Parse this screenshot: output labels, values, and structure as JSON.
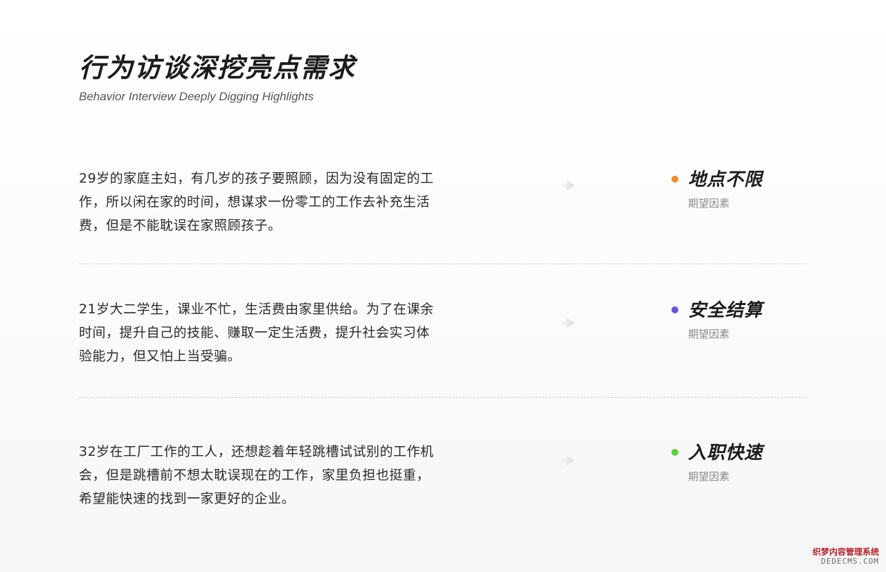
{
  "header": {
    "title": "行为访谈深挖亮点需求",
    "subtitle": "Behavior Interview Deeply Digging Highlights"
  },
  "rows": [
    {
      "description": "29岁的家庭主妇，有几岁的孩子要照顾，因为没有固定的工作，所以闲在家的时间，想谋求一份零工的工作去补充生活费，但是不能耽误在家照顾孩子。",
      "factor": "地点不限",
      "caption": "期望因素",
      "dot_color": "#f0892a"
    },
    {
      "description": "21岁大二学生，课业不忙，生活费由家里供给。为了在课余时间，提升自己的技能、赚取一定生活费，提升社会实习体验能力，但又怕上当受骗。",
      "factor": "安全结算",
      "caption": "期望因素",
      "dot_color": "#6b4fe6"
    },
    {
      "description": "32岁在工厂工作的工人，还想趁着年轻跳槽试试别的工作机会，但是跳槽前不想太耽误现在的工作，家里负担也挺重，希望能快速的找到一家更好的企业。",
      "factor": "入职快速",
      "caption": "期望因素",
      "dot_color": "#5ccd3f"
    }
  ],
  "watermark": {
    "cn": "织梦内容管理系统",
    "en": "DEDECMS.COM"
  },
  "icons": {
    "arrow": "arrow-right-icon",
    "dot": "bullet-dot-icon"
  }
}
